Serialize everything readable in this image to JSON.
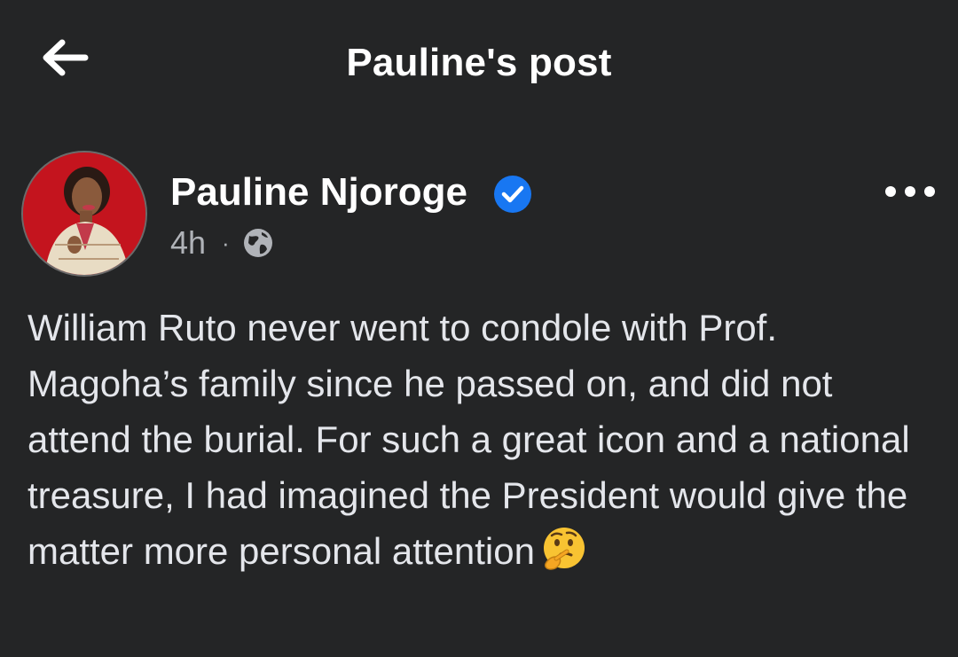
{
  "topbar": {
    "back_icon": "arrow-left-icon",
    "title": "Pauline's post"
  },
  "post": {
    "author": {
      "name": "Pauline Njoroge",
      "verified": true,
      "verified_icon": "verified-badge-icon",
      "avatar_bg": "#c4141e"
    },
    "timestamp": "4h",
    "separator": "·",
    "privacy_icon": "globe-icon",
    "more_icon": "more-horizontal-icon",
    "text": "William Ruto never went to condole with Prof. Magoha’s family since he passed on, and did not attend the burial. For such a great icon and a national treasure, I had imagined the President would give the matter more personal attention",
    "emoji_icon": "thinking-face-emoji"
  },
  "colors": {
    "background": "#242526",
    "primary_text": "#e4e6eb",
    "secondary_text": "#b0b3b8",
    "verified_blue": "#1877f2"
  }
}
